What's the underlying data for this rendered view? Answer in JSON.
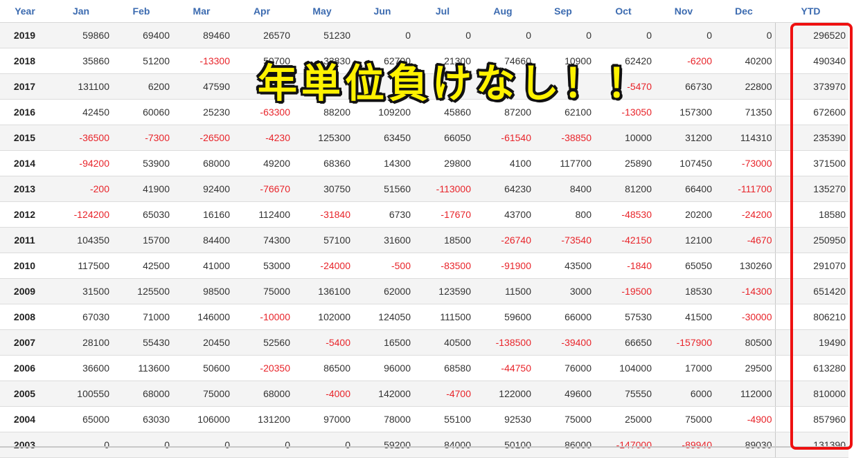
{
  "headers": [
    "Year",
    "Jan",
    "Feb",
    "Mar",
    "Apr",
    "May",
    "Jun",
    "Jul",
    "Aug",
    "Sep",
    "Oct",
    "Nov",
    "Dec",
    "YTD"
  ],
  "rows": [
    [
      "2019",
      "59860",
      "69400",
      "89460",
      "26570",
      "51230",
      "0",
      "0",
      "0",
      "0",
      "0",
      "0",
      "0",
      "296520"
    ],
    [
      "2018",
      "35860",
      "51200",
      "-13300",
      "50700",
      "33830",
      "62700",
      "21300",
      "74660",
      "10900",
      "62420",
      "-6200",
      "40200",
      "490340"
    ],
    [
      "2017",
      "131100",
      "6200",
      "47590",
      "",
      "",
      "",
      "",
      "",
      "",
      "-5470",
      "66730",
      "22800",
      "373970"
    ],
    [
      "2016",
      "42450",
      "60060",
      "25230",
      "-63300",
      "88200",
      "109200",
      "45860",
      "87200",
      "62100",
      "-13050",
      "157300",
      "71350",
      "672600"
    ],
    [
      "2015",
      "-36500",
      "-7300",
      "-26500",
      "-4230",
      "125300",
      "63450",
      "66050",
      "-61540",
      "-38850",
      "10000",
      "31200",
      "114310",
      "235390"
    ],
    [
      "2014",
      "-94200",
      "53900",
      "68000",
      "49200",
      "68360",
      "14300",
      "29800",
      "4100",
      "117700",
      "25890",
      "107450",
      "-73000",
      "371500"
    ],
    [
      "2013",
      "-200",
      "41900",
      "92400",
      "-76670",
      "30750",
      "51560",
      "-113000",
      "64230",
      "8400",
      "81200",
      "66400",
      "-111700",
      "135270"
    ],
    [
      "2012",
      "-124200",
      "65030",
      "16160",
      "112400",
      "-31840",
      "6730",
      "-17670",
      "43700",
      "800",
      "-48530",
      "20200",
      "-24200",
      "18580"
    ],
    [
      "2011",
      "104350",
      "15700",
      "84400",
      "74300",
      "57100",
      "31600",
      "18500",
      "-26740",
      "-73540",
      "-42150",
      "12100",
      "-4670",
      "250950"
    ],
    [
      "2010",
      "117500",
      "42500",
      "41000",
      "53000",
      "-24000",
      "-500",
      "-83500",
      "-91900",
      "43500",
      "-1840",
      "65050",
      "130260",
      "291070"
    ],
    [
      "2009",
      "31500",
      "125500",
      "98500",
      "75000",
      "136100",
      "62000",
      "123590",
      "11500",
      "3000",
      "-19500",
      "18530",
      "-14300",
      "651420"
    ],
    [
      "2008",
      "67030",
      "71000",
      "146000",
      "-10000",
      "102000",
      "124050",
      "111500",
      "59600",
      "66000",
      "57530",
      "41500",
      "-30000",
      "806210"
    ],
    [
      "2007",
      "28100",
      "55430",
      "20450",
      "52560",
      "-5400",
      "16500",
      "40500",
      "-138500",
      "-39400",
      "66650",
      "-157900",
      "80500",
      "19490"
    ],
    [
      "2006",
      "36600",
      "113600",
      "50600",
      "-20350",
      "86500",
      "96000",
      "68580",
      "-44750",
      "76000",
      "104000",
      "17000",
      "29500",
      "613280"
    ],
    [
      "2005",
      "100550",
      "68000",
      "75000",
      "68000",
      "-4000",
      "142000",
      "-4700",
      "122000",
      "49600",
      "75550",
      "6000",
      "112000",
      "810000"
    ],
    [
      "2004",
      "65000",
      "63030",
      "106000",
      "131200",
      "97000",
      "78000",
      "55100",
      "92530",
      "75000",
      "25000",
      "75000",
      "-4900",
      "857960"
    ],
    [
      "2003",
      "0",
      "0",
      "0",
      "0",
      "0",
      "59200",
      "84000",
      "50100",
      "86000",
      "-147000",
      "-89940",
      "89030",
      "131390"
    ]
  ],
  "overlay_text": "年単位負けなし！！",
  "colors": {
    "header_text": "#3c6bb0",
    "negative": "#e8242a",
    "highlight_box": "#ee1111",
    "overlay_fill": "#fff200",
    "overlay_outline": "#111111"
  }
}
